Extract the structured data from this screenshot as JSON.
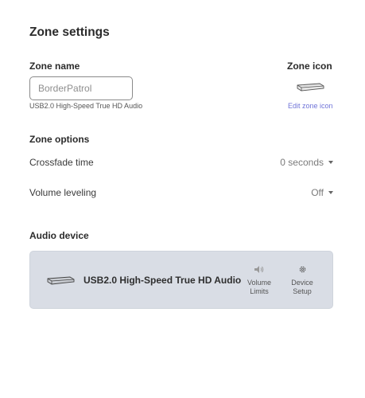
{
  "page": {
    "title": "Zone settings"
  },
  "zone_name": {
    "label": "Zone name",
    "placeholder": "BorderPatrol",
    "value": "",
    "caption": "USB2.0 High-Speed True HD Audio"
  },
  "zone_icon": {
    "label": "Zone icon",
    "icon": "audio-device-icon",
    "edit_link": "Edit zone icon"
  },
  "zone_options": {
    "label": "Zone options",
    "crossfade": {
      "label": "Crossfade time",
      "value": "0 seconds"
    },
    "volume_leveling": {
      "label": "Volume leveling",
      "value": "Off"
    }
  },
  "audio_device": {
    "label": "Audio device",
    "name": "USB2.0 High-Speed True HD Audio",
    "volume_limits": {
      "line1": "Volume",
      "line2": "Limits",
      "icon": "speaker-icon"
    },
    "device_setup": {
      "line1": "Device",
      "line2": "Setup",
      "icon": "gear-icon"
    }
  },
  "colors": {
    "link": "#7074d8",
    "card_bg": "#d9dde5",
    "text": "#333333"
  }
}
